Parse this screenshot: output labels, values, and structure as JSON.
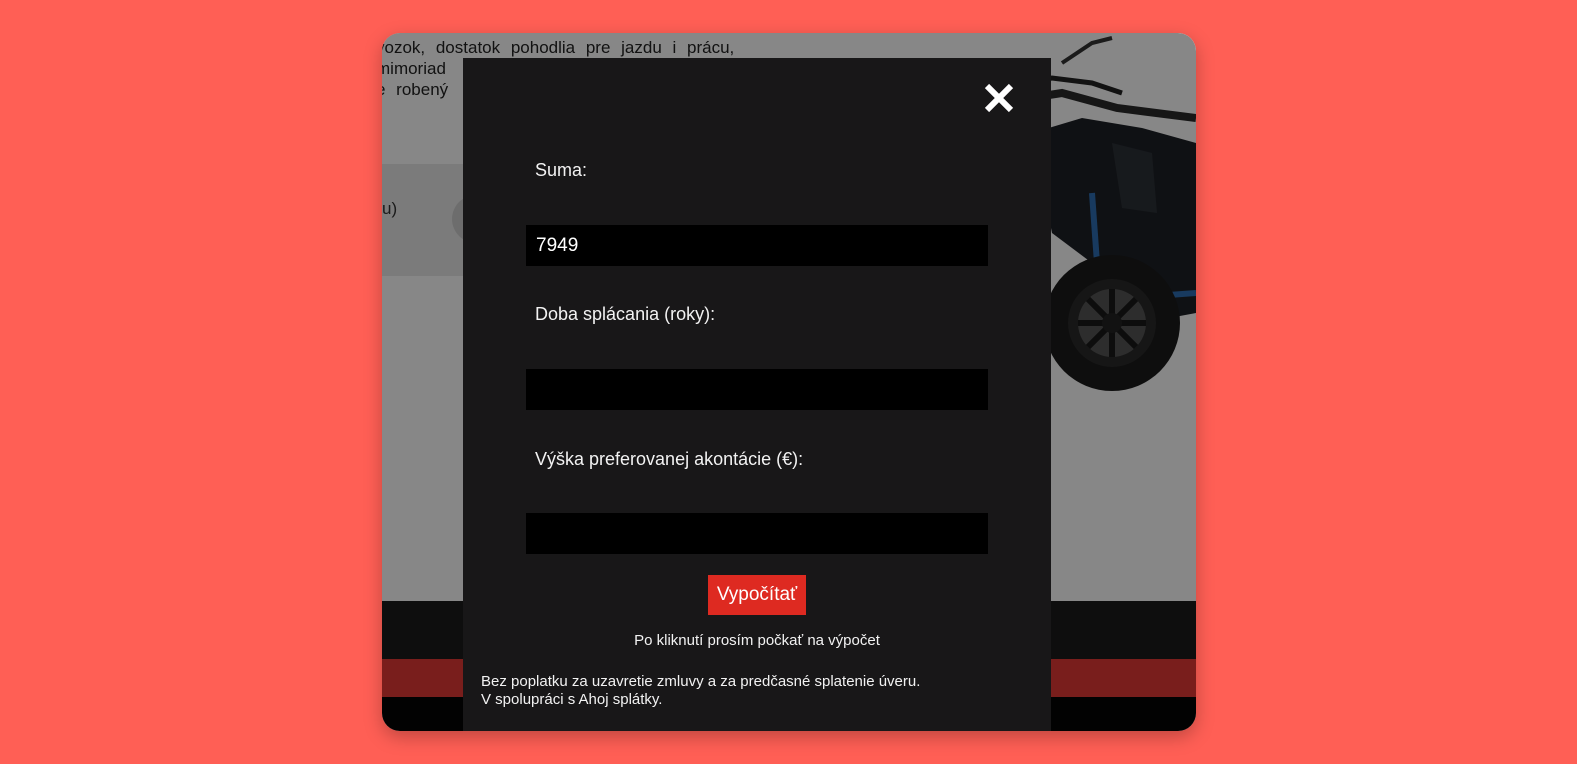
{
  "background_page": {
    "text_lines": [
      "vozok, dostatok pohodlia pre jazdu i prácu,",
      "mimoriad",
      "e robený"
    ],
    "side_label": "u)"
  },
  "modal": {
    "close_icon": "close-icon",
    "fields": [
      {
        "label": "Suma:",
        "value": "7949",
        "placeholder": ""
      },
      {
        "label": "Doba splácania (roky):",
        "value": "",
        "placeholder": ""
      },
      {
        "label": "Výška preferovanej akontácie (€):",
        "value": "",
        "placeholder": ""
      }
    ],
    "calculate_label": "Vypočítať",
    "wait_note": "Po kliknutí prosím počkať na výpočet",
    "footnote_line1": "Bez poplatku za uzavretie zmluvy a za predčasné splatenie úveru.",
    "footnote_line2": "V spolupráci s Ahoj splátky."
  },
  "colors": {
    "page_background": "#ff5f55",
    "modal_background": "#181718",
    "input_background": "#000000",
    "button_accent": "#de2a21"
  }
}
